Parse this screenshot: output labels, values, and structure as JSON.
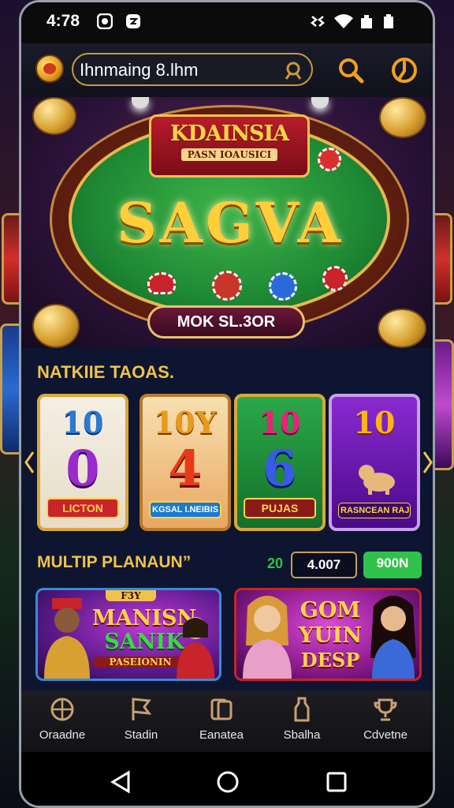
{
  "status_bar": {
    "time": "4:78"
  },
  "app_bar": {
    "search_value": "Ihnmaing 8.lhm"
  },
  "hero": {
    "banner_title": "KDAINSIA",
    "banner_subtitle": "PASN IOAUSICI",
    "main_title": "SAGVA",
    "cta_label": "MOK SL.3OR"
  },
  "section_games": {
    "title": "NATKIIE TAOAS.",
    "cards": [
      {
        "top": "10",
        "big": "0",
        "label": "LICTON"
      },
      {
        "top": "10Y",
        "big": "4",
        "label": "KGSAL I.NEIBIS"
      },
      {
        "top": "10",
        "big": "6",
        "label": "PUJAS"
      },
      {
        "top": "10",
        "big": "",
        "label": "RASNCEAN RAJUSUIN"
      }
    ]
  },
  "section_multi": {
    "title": "MULTIP PLANAUN”",
    "count": "20",
    "score": "4.007",
    "action_label": "900N"
  },
  "promos": [
    {
      "tag": "F3Y",
      "title_line1": "MANISN",
      "title_line2": "SANIK",
      "sub": "PASEIONIN"
    },
    {
      "title_line1": "GOM",
      "title_line2": "YUIN",
      "title_line3": "DESP"
    }
  ],
  "bottom_nav": [
    {
      "label": "Oraadne",
      "icon": "globe-icon"
    },
    {
      "label": "Stadin",
      "icon": "flag-icon"
    },
    {
      "label": "Eanatea",
      "icon": "cards-icon"
    },
    {
      "label": "Sbalha",
      "icon": "bottle-icon"
    },
    {
      "label": "Cdvetne",
      "icon": "trophy-icon"
    }
  ],
  "colors": {
    "accent_gold": "#f0c24a",
    "felt_green": "#1e8a34",
    "nav_bg": "#1c1c22",
    "action_green": "#2fc24a"
  }
}
